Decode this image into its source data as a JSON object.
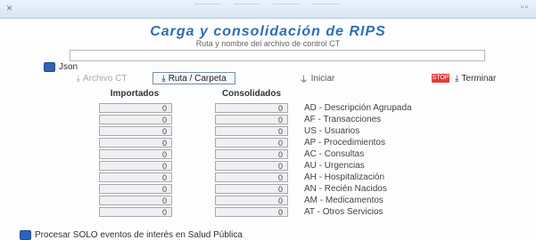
{
  "window": {
    "close_glyph": "×",
    "controls_glyph": "▫▫"
  },
  "app": {
    "title": "Carga y consolidación de RIPS",
    "path_label": "Ruta y nombre del archivo de control CT",
    "path_value": ""
  },
  "options": {
    "json_label": "Json",
    "json_checked": true,
    "salud_publica_label": "Procesar SOLO eventos de interés en Salud Pública",
    "salud_publica_checked": true
  },
  "toolbar": {
    "archivo_ct": "Archivo CT",
    "ruta_carpeta": "Ruta / Carpeta",
    "iniciar": "Iniciar",
    "terminar": "Terminar",
    "terminar_badge": "STOP"
  },
  "table": {
    "col_importados": "Importados",
    "col_consolidados": "Consolidados",
    "rows": [
      {
        "importados": "0",
        "consolidados": "0",
        "label": "AD - Descripción Agrupada"
      },
      {
        "importados": "0",
        "consolidados": "0",
        "label": "AF - Transacciones"
      },
      {
        "importados": "0",
        "consolidados": "0",
        "label": "US - Usuarios"
      },
      {
        "importados": "0",
        "consolidados": "0",
        "label": "AP - Procedimientos"
      },
      {
        "importados": "0",
        "consolidados": "0",
        "label": "AC - Consultas"
      },
      {
        "importados": "0",
        "consolidados": "0",
        "label": "AU - Urgencias"
      },
      {
        "importados": "0",
        "consolidados": "0",
        "label": "AH - Hospitalización"
      },
      {
        "importados": "0",
        "consolidados": "0",
        "label": "AN - Recién Nacidos"
      },
      {
        "importados": "0",
        "consolidados": "0",
        "label": "AM - Medicamentos"
      },
      {
        "importados": "0",
        "consolidados": "0",
        "label": "AT - Otros Servicios"
      }
    ]
  },
  "colors": {
    "title": "#2f6db8",
    "checkbox": "#2f62b7",
    "stop_badge": "#e23c3c"
  }
}
